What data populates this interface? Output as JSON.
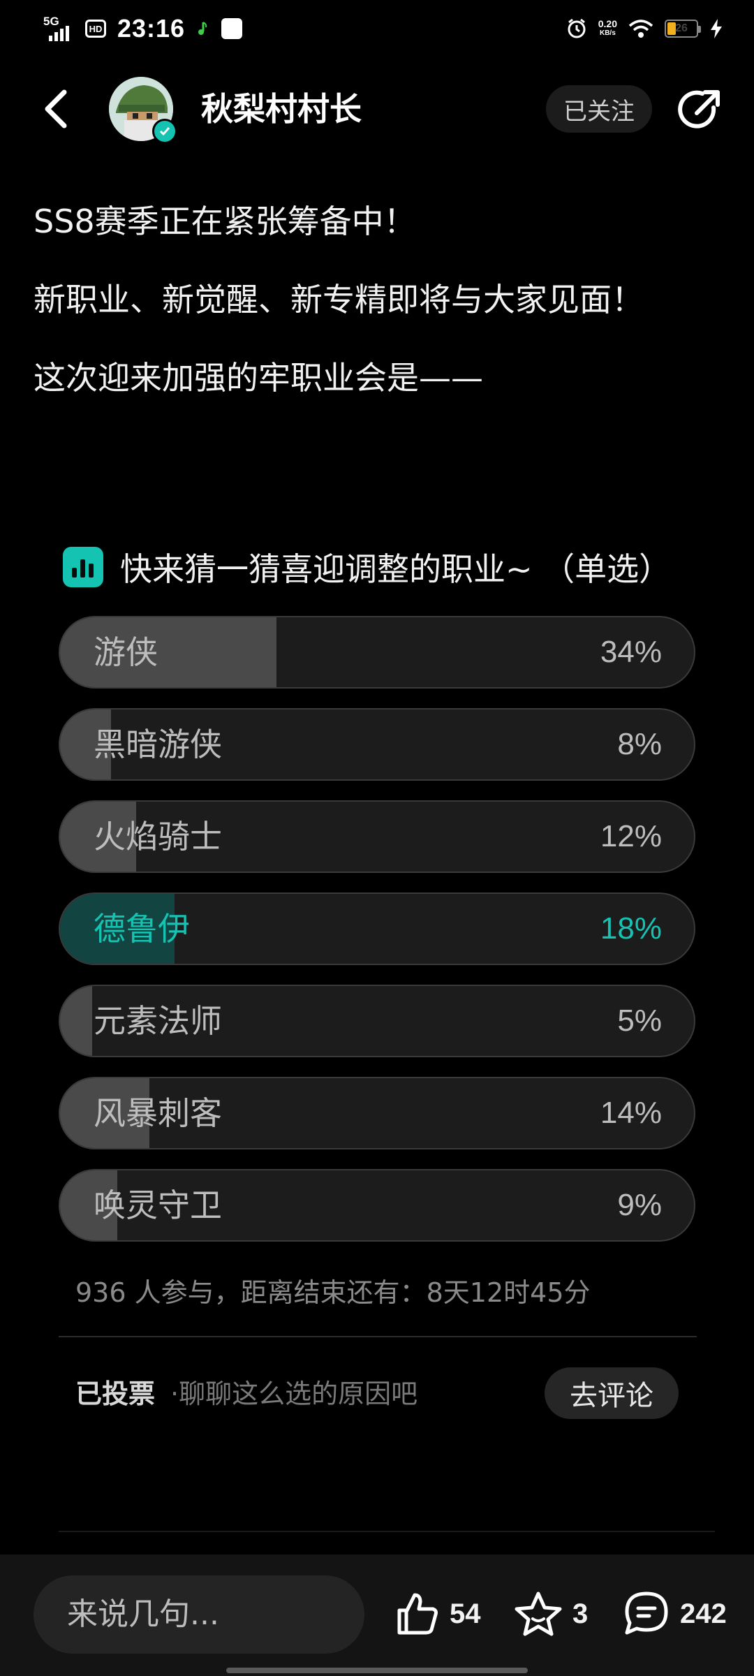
{
  "status_bar": {
    "network": "5G",
    "hd": "HD",
    "time": "23:16",
    "speed_value": "0.20",
    "speed_unit": "KB/s",
    "battery": "26"
  },
  "header": {
    "author_name": "秋梨村村长",
    "follow_label": "已关注"
  },
  "post": {
    "paragraphs": [
      "SS8赛季正在紧张筹备中！",
      "新职业、新觉醒、新专精即将与大家见面！",
      "这次迎来加强的牢职业会是——"
    ]
  },
  "poll": {
    "title": "快来猜一猜喜迎调整的职业~ （单选）",
    "options": [
      {
        "label": "游侠",
        "percent": "34%",
        "fraction": 0.34,
        "selected": false
      },
      {
        "label": "黑暗游侠",
        "percent": "8%",
        "fraction": 0.08,
        "selected": false
      },
      {
        "label": "火焰骑士",
        "percent": "12%",
        "fraction": 0.12,
        "selected": false
      },
      {
        "label": "德鲁伊",
        "percent": "18%",
        "fraction": 0.18,
        "selected": true
      },
      {
        "label": "元素法师",
        "percent": "5%",
        "fraction": 0.05,
        "selected": false
      },
      {
        "label": "风暴刺客",
        "percent": "14%",
        "fraction": 0.14,
        "selected": false
      },
      {
        "label": "唤灵守卫",
        "percent": "9%",
        "fraction": 0.09,
        "selected": false
      }
    ],
    "stats": "936 人参与，距离结束还有：8天12时45分",
    "voted_label": "已投票",
    "voted_hint": "·聊聊这么选的原因吧",
    "comment_button": "去评论"
  },
  "bottom_bar": {
    "input_placeholder": "来说几句...",
    "likes": "54",
    "favorites": "3",
    "comments": "242"
  },
  "colors": {
    "accent": "#15c3b2",
    "background": "#000000",
    "option_bg": "#1c1c1c",
    "option_fill": "#4a4a4a",
    "selected_fill": "#124541"
  }
}
